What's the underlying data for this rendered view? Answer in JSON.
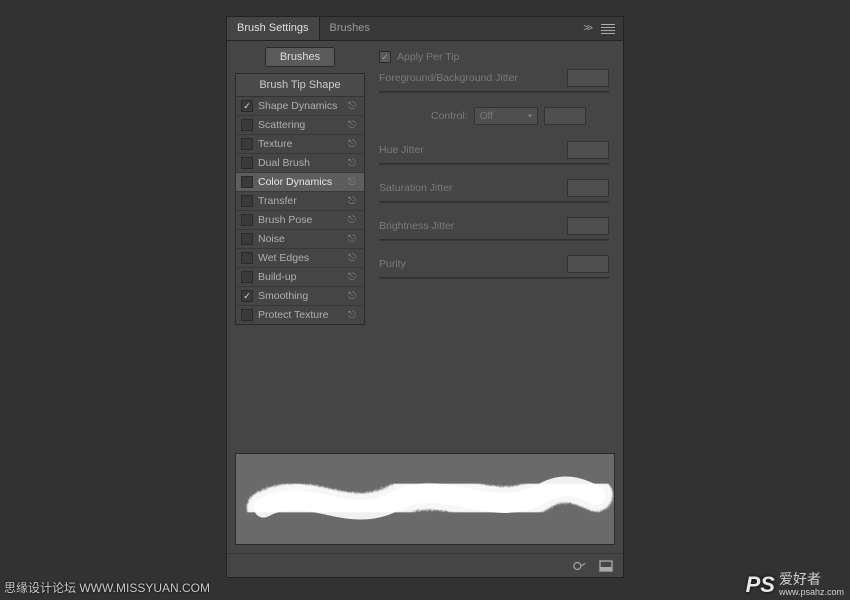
{
  "tabs": {
    "settings": "Brush Settings",
    "brushes": "Brushes"
  },
  "left": {
    "brushes_btn": "Brushes",
    "tip_shape": "Brush Tip Shape",
    "rows": [
      {
        "label": "Shape Dynamics",
        "checked": true
      },
      {
        "label": "Scattering",
        "checked": false
      },
      {
        "label": "Texture",
        "checked": false
      },
      {
        "label": "Dual Brush",
        "checked": false
      },
      {
        "label": "Color Dynamics",
        "checked": false
      },
      {
        "label": "Transfer",
        "checked": false
      },
      {
        "label": "Brush Pose",
        "checked": false
      },
      {
        "label": "Noise",
        "checked": false
      },
      {
        "label": "Wet Edges",
        "checked": false
      },
      {
        "label": "Build-up",
        "checked": false
      },
      {
        "label": "Smoothing",
        "checked": true
      },
      {
        "label": "Protect Texture",
        "checked": false
      }
    ]
  },
  "right": {
    "apply_per_tip": "Apply Per Tip",
    "fg_bg_jitter": "Foreground/Background Jitter",
    "control": "Control:",
    "control_value": "Off",
    "hue_jitter": "Hue Jitter",
    "sat_jitter": "Saturation Jitter",
    "bri_jitter": "Brightness Jitter",
    "purity": "Purity"
  },
  "watermark": {
    "left": "思缘设计论坛  WWW.MISSYUAN.COM",
    "ps": "PS",
    "right_cn": "爱好者",
    "right_url": "www.psahz.com"
  }
}
